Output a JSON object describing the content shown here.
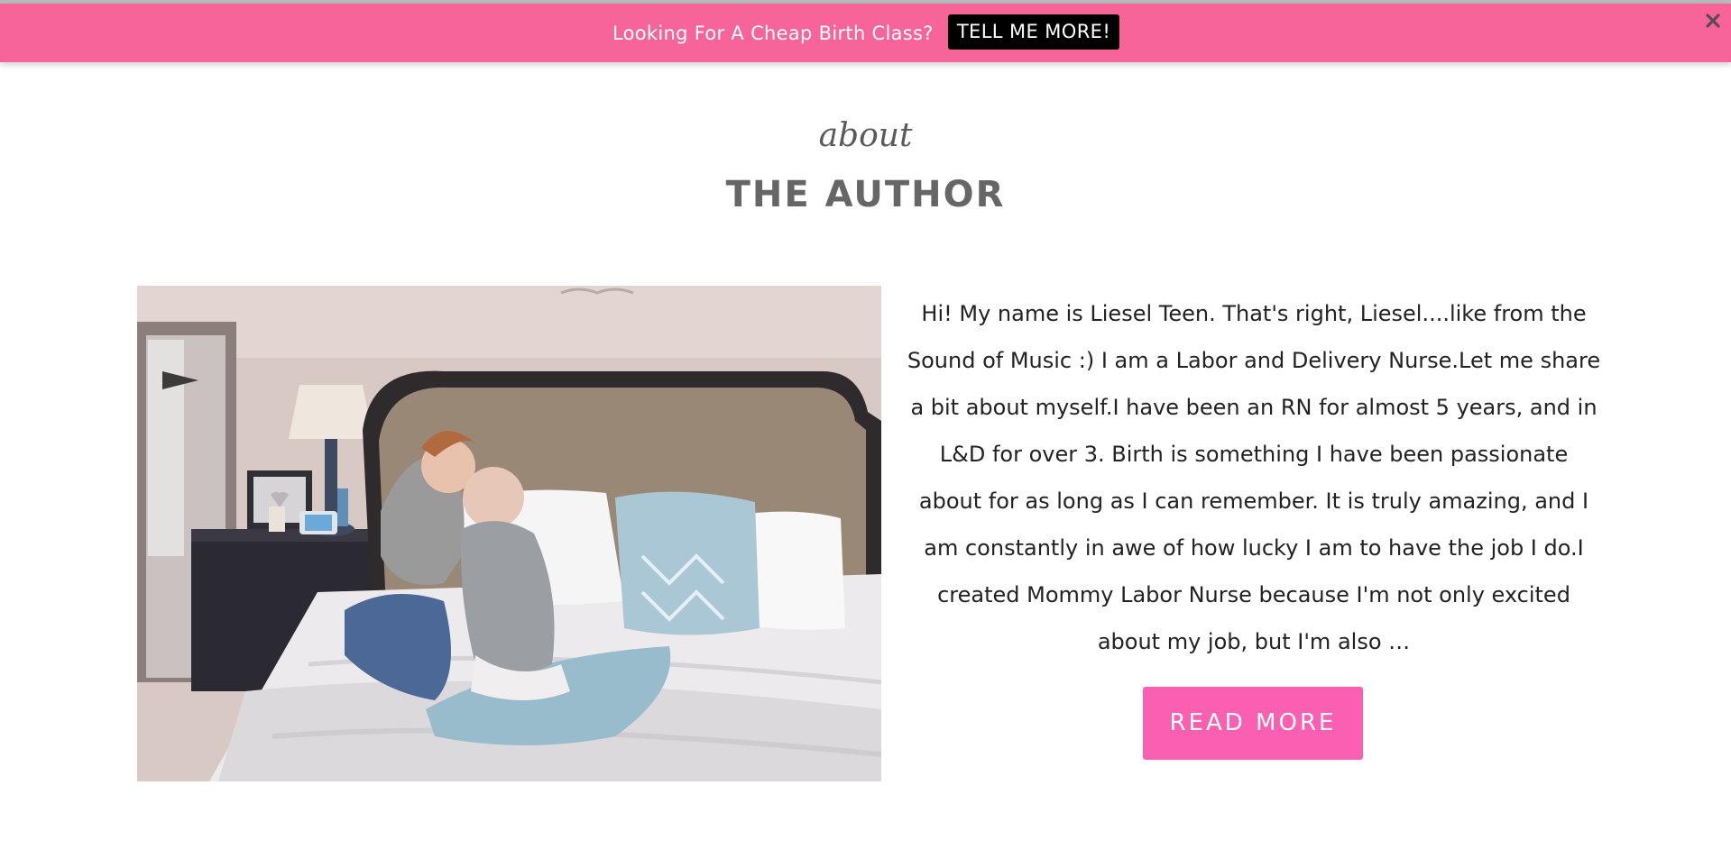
{
  "promo": {
    "text": "Looking For A Cheap Birth Class?",
    "button_label": "TELL ME MORE!",
    "close_icon": "close-icon"
  },
  "about": {
    "script_label": "about",
    "heading": "THE AUTHOR",
    "photo": "author-photo",
    "bio": "Hi! My name is Liesel Teen. That's right, Liesel....like from the Sound of Music :) I am a Labor and Delivery Nurse.Let me share a bit about myself.I have been an RN for almost 5 years, and in L&D for over 3. Birth is something I have been passionate about for as long as I can remember. It is truly amazing, and I am constantly in awe of how lucky I am to have the job I do.I created Mommy Labor Nurse because I'm not only excited about my job, but I'm also …",
    "read_more_label": "READ MORE"
  },
  "colors": {
    "promo_bar": "#f6649a",
    "read_more": "#fb5fb1",
    "heading": "#666666"
  }
}
